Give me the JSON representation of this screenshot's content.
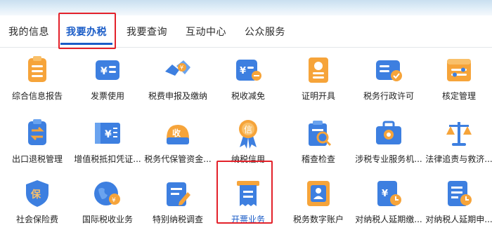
{
  "tabs": [
    {
      "label": "我的信息"
    },
    {
      "label": "我要办税"
    },
    {
      "label": "我要查询"
    },
    {
      "label": "互动中心"
    },
    {
      "label": "公众服务"
    }
  ],
  "active_tab": "我要办税",
  "items": [
    {
      "label": "综合信息报告",
      "icon": "report-icon"
    },
    {
      "label": "发票使用",
      "icon": "invoice-icon"
    },
    {
      "label": "税费申报及缴纳",
      "icon": "tax-payment-icon"
    },
    {
      "label": "税收减免",
      "icon": "tax-reduction-icon"
    },
    {
      "label": "证明开具",
      "icon": "certificate-icon"
    },
    {
      "label": "税务行政许可",
      "icon": "admin-permit-icon"
    },
    {
      "label": "核定管理",
      "icon": "assessment-icon"
    },
    {
      "label": "出口退税管理",
      "icon": "export-refund-icon"
    },
    {
      "label": "增值税抵扣凭证...",
      "icon": "vat-voucher-icon"
    },
    {
      "label": "税务代保管资金...",
      "icon": "custody-fund-icon"
    },
    {
      "label": "纳税信用",
      "icon": "credit-icon"
    },
    {
      "label": "稽查检查",
      "icon": "inspection-icon"
    },
    {
      "label": "涉税专业服务机...",
      "icon": "professional-service-icon"
    },
    {
      "label": "法律追责与救济...",
      "icon": "law-scale-icon"
    },
    {
      "label": "社会保险费",
      "icon": "social-insurance-icon"
    },
    {
      "label": "国际税收业务",
      "icon": "globe-icon"
    },
    {
      "label": "特别纳税调查",
      "icon": "special-investigation-icon"
    },
    {
      "label": "开票业务",
      "icon": "invoicing-icon"
    },
    {
      "label": "税务数字账户",
      "icon": "digital-account-icon"
    },
    {
      "label": "对纳税人延期缴...",
      "icon": "deferred-payment-icon"
    },
    {
      "label": "对纳税人延期申...",
      "icon": "deferred-filing-icon"
    }
  ],
  "colors": {
    "accent": "#1a5cc7",
    "highlight": "#e3212a",
    "icon_blue": "#3d7fe0",
    "icon_orange": "#f6a43a"
  }
}
